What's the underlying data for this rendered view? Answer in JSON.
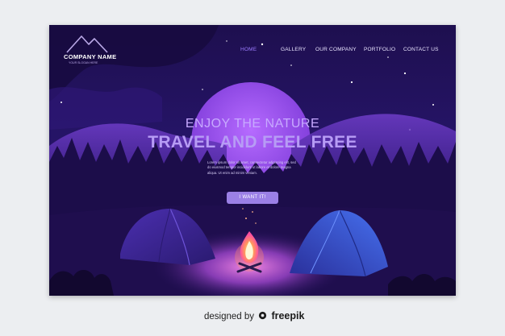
{
  "brand": {
    "name": "COMPANY NAME",
    "tagline": "YOUR SLOGAN HERE"
  },
  "nav": {
    "items": [
      {
        "label": "HOME",
        "active": true
      },
      {
        "label": "GALLERY",
        "active": false
      },
      {
        "label": "OUR COMPANY",
        "active": false
      },
      {
        "label": "PORTFOLIO",
        "active": false
      },
      {
        "label": "CONTACT US",
        "active": false
      }
    ]
  },
  "hero": {
    "kicker": "ENJOY THE NATURE",
    "headline": "TRAVEL AND FEEL FREE",
    "body": "Lorem ipsum dolor sit amet, consectetur adipiscing elit, sed do eiusmod tempor incididunt ut labore et dolore magna aliqua. Ut enim ad minim veniam.",
    "cta_label": "I WANT IT!"
  },
  "credit": {
    "prefix": "designed by",
    "brand": "freepik"
  },
  "colors": {
    "sky": "#251466",
    "moon": "#9b4cf0",
    "accent": "#9b80e6",
    "nav_active": "#9c7cff",
    "fire": "#ff7b4a",
    "tent_left": "#4a2ea8",
    "tent_right": "#3a5be0"
  }
}
